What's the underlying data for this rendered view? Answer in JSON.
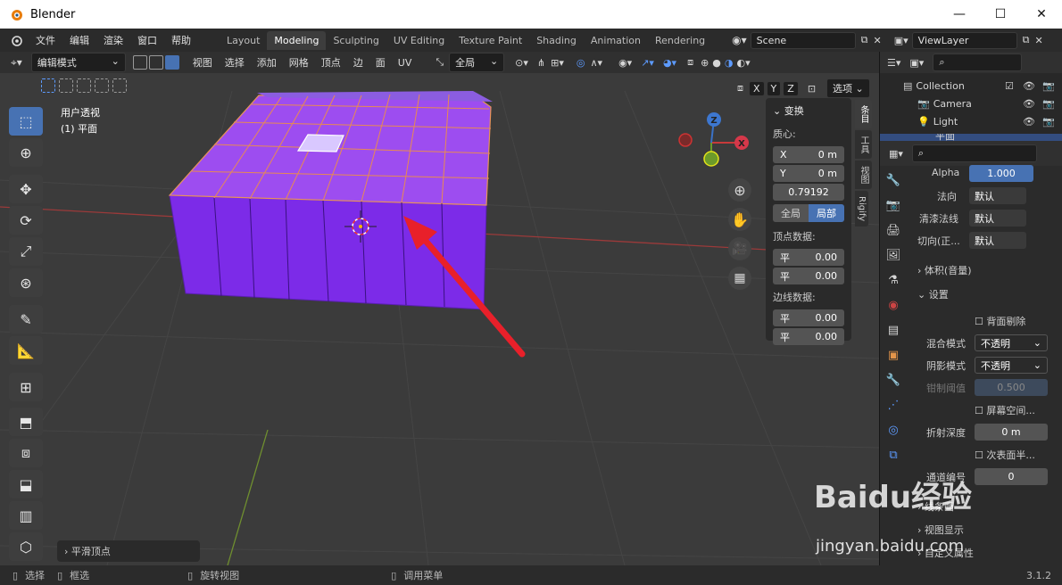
{
  "window": {
    "title": "Blender",
    "minimize": "—",
    "maximize": "☐",
    "close": "✕"
  },
  "menu": [
    "文件",
    "编辑",
    "渲染",
    "窗口",
    "帮助"
  ],
  "workspaces": [
    "Layout",
    "Modeling",
    "Sculpting",
    "UV Editing",
    "Texture Paint",
    "Shading",
    "Animation",
    "Rendering"
  ],
  "active_workspace": "Modeling",
  "scene": "Scene",
  "view_layer": "ViewLayer",
  "viewport_header": {
    "mode": "编辑模式",
    "menus": [
      "视图",
      "选择",
      "添加",
      "网格",
      "顶点",
      "边",
      "面",
      "UV"
    ],
    "transform_orientation": "全局",
    "axes": [
      "X",
      "Y",
      "Z"
    ],
    "options": "选项"
  },
  "viewport": {
    "view_name": "用户透视",
    "object_name": "(1) 平面",
    "last_op": "平滑顶点",
    "gizmo_x": "X",
    "gizmo_y": "Y",
    "gizmo_z": "Z"
  },
  "npanel": {
    "section": "变换",
    "median": "质心:",
    "x_label": "X",
    "x_val": "0 m",
    "y_label": "Y",
    "y_val": "0 m",
    "z_val": "0.79192",
    "global": "全局",
    "local": "局部",
    "vertex_data": "顶点数据:",
    "vd1_label": "平",
    "vd1_val": "0.00",
    "vd2_label": "平",
    "vd2_val": "0.00",
    "edge_data": "边线数据:",
    "ed1_label": "平",
    "ed1_val": "0.00",
    "ed2_label": "平",
    "ed2_val": "0.00",
    "tabs": [
      "条目",
      "工具",
      "视图",
      "Rigify"
    ]
  },
  "outliner": {
    "items": [
      {
        "label": "Collection"
      },
      {
        "label": "Camera"
      },
      {
        "label": "Light"
      },
      {
        "label": "平面"
      }
    ]
  },
  "properties": {
    "alpha_label": "Alpha",
    "alpha_val": "1.000",
    "normal_label": "法向",
    "normal_val": "默认",
    "clearcoat_label": "清漆法线",
    "clearcoat_val": "默认",
    "tangent_label": "切向(正...",
    "tangent_val": "默认",
    "volume_section": "体积(音量)",
    "settings_section": "设置",
    "backface": "背面剔除",
    "blend_label": "混合模式",
    "blend_val": "不透明",
    "shadow_label": "阴影模式",
    "shadow_val": "不透明",
    "clip_label": "钳制阈值",
    "clip_val": "0.500",
    "screen_space": "屏幕空间...",
    "refraction_label": "折射深度",
    "refraction_val": "0 m",
    "subsurface": "次表面半...",
    "pass_label": "通道编号",
    "pass_val": "0",
    "lineart": "线条画",
    "viewport_display": "视图显示",
    "custom_props": "自定义属性"
  },
  "status": {
    "select": "选择",
    "box_select": "框选",
    "rotate_view": "旋转视图",
    "call_menu": "调用菜单",
    "version": "3.1.2"
  },
  "colors": {
    "accent": "#4772b3",
    "mesh_face": "#8a2be2",
    "arrow": "#e8202a"
  },
  "watermark": {
    "brand": "Baidu经验",
    "url": "jingyan.baidu.com"
  }
}
